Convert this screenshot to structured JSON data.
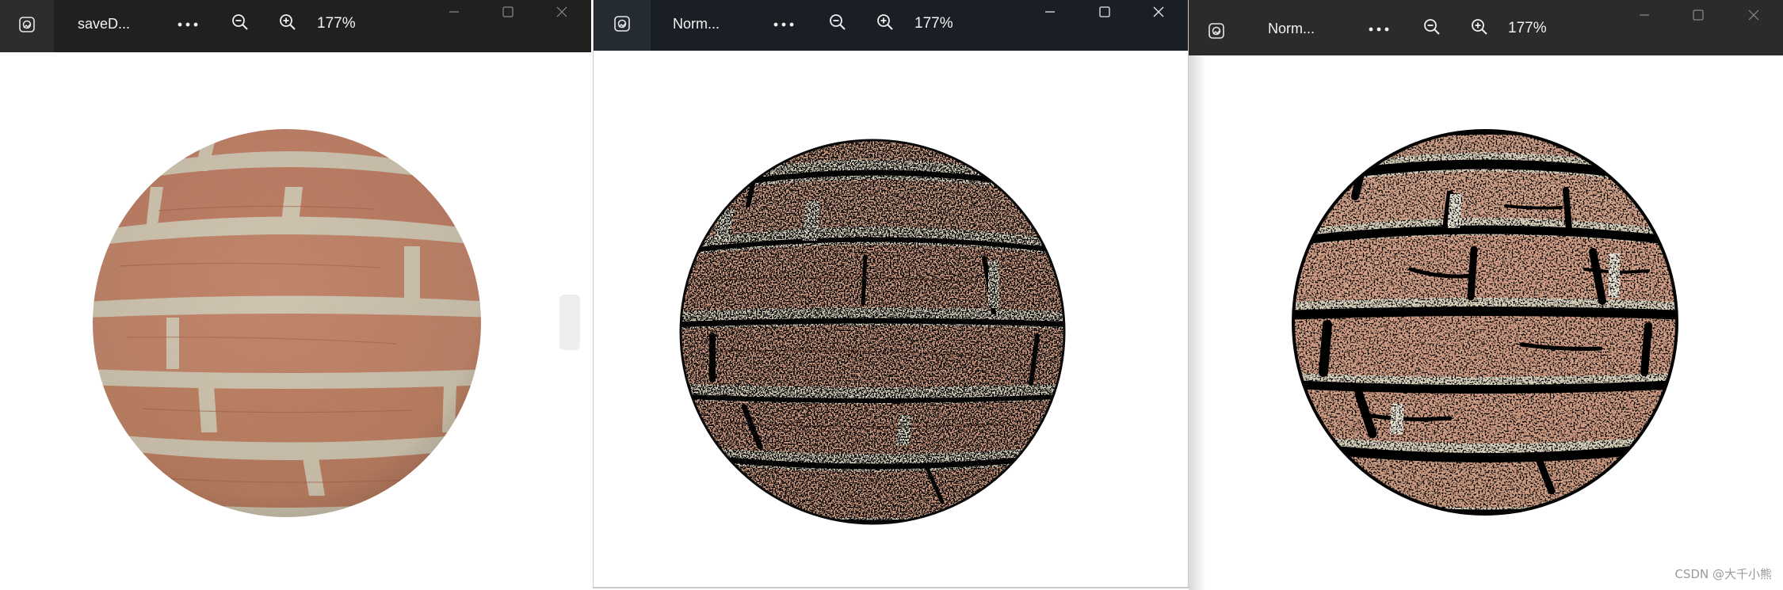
{
  "windows": [
    {
      "title": "saveD...",
      "zoom": "177%",
      "icons": [
        "photos-app-icon",
        "more-icon",
        "zoom-out-icon",
        "zoom-in-icon",
        "minimize-icon",
        "maximize-icon",
        "close-icon"
      ]
    },
    {
      "title": "Norm...",
      "zoom": "177%",
      "icons": [
        "photos-app-icon",
        "more-icon",
        "zoom-out-icon",
        "zoom-in-icon",
        "minimize-icon",
        "maximize-icon",
        "close-icon"
      ]
    },
    {
      "title": "Norm...",
      "zoom": "177%",
      "icons": [
        "photos-app-icon",
        "more-icon",
        "zoom-out-icon",
        "zoom-in-icon",
        "minimize-icon",
        "maximize-icon",
        "close-icon"
      ]
    }
  ],
  "watermark": "CSDN @大千小熊",
  "colors": {
    "titlebar_dark": "#202020",
    "brick": "#c98a6c",
    "mortar": "#d9d0bd",
    "crack_dark": "#0a0a0a"
  }
}
